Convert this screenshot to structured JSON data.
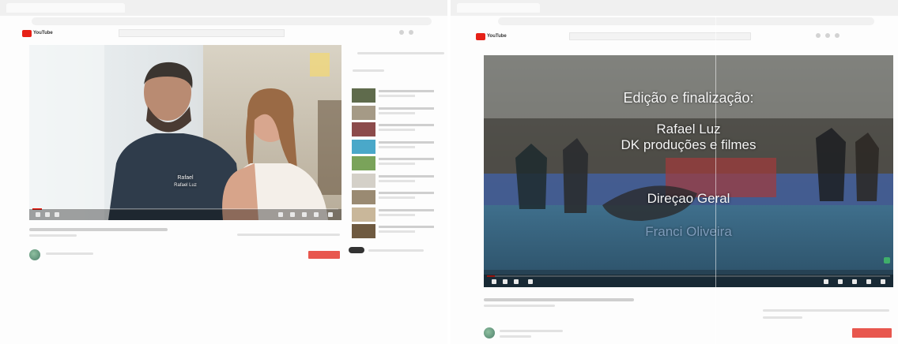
{
  "left_window": {
    "logo_text": "YouTube",
    "player": {
      "caption_line1": "Rafael",
      "caption_line2": "Rafael Luz",
      "progress": 0.03
    },
    "recommendations_count": 9
  },
  "right_window": {
    "logo_text": "YouTube",
    "player": {
      "credit_heading": "Edição e finalização:",
      "credit_name": "Rafael Luz",
      "credit_company": "DK produções e filmes",
      "credit_role": "Direçao Geral",
      "credit_director": "Franci Oliveira",
      "progress": 0.02
    }
  },
  "colors": {
    "brand_red": "#e62117",
    "subscribe": "#e8574e"
  },
  "icons": [
    "youtube-logo-icon",
    "play-icon",
    "volume-icon",
    "settings-icon",
    "fullscreen-icon"
  ]
}
